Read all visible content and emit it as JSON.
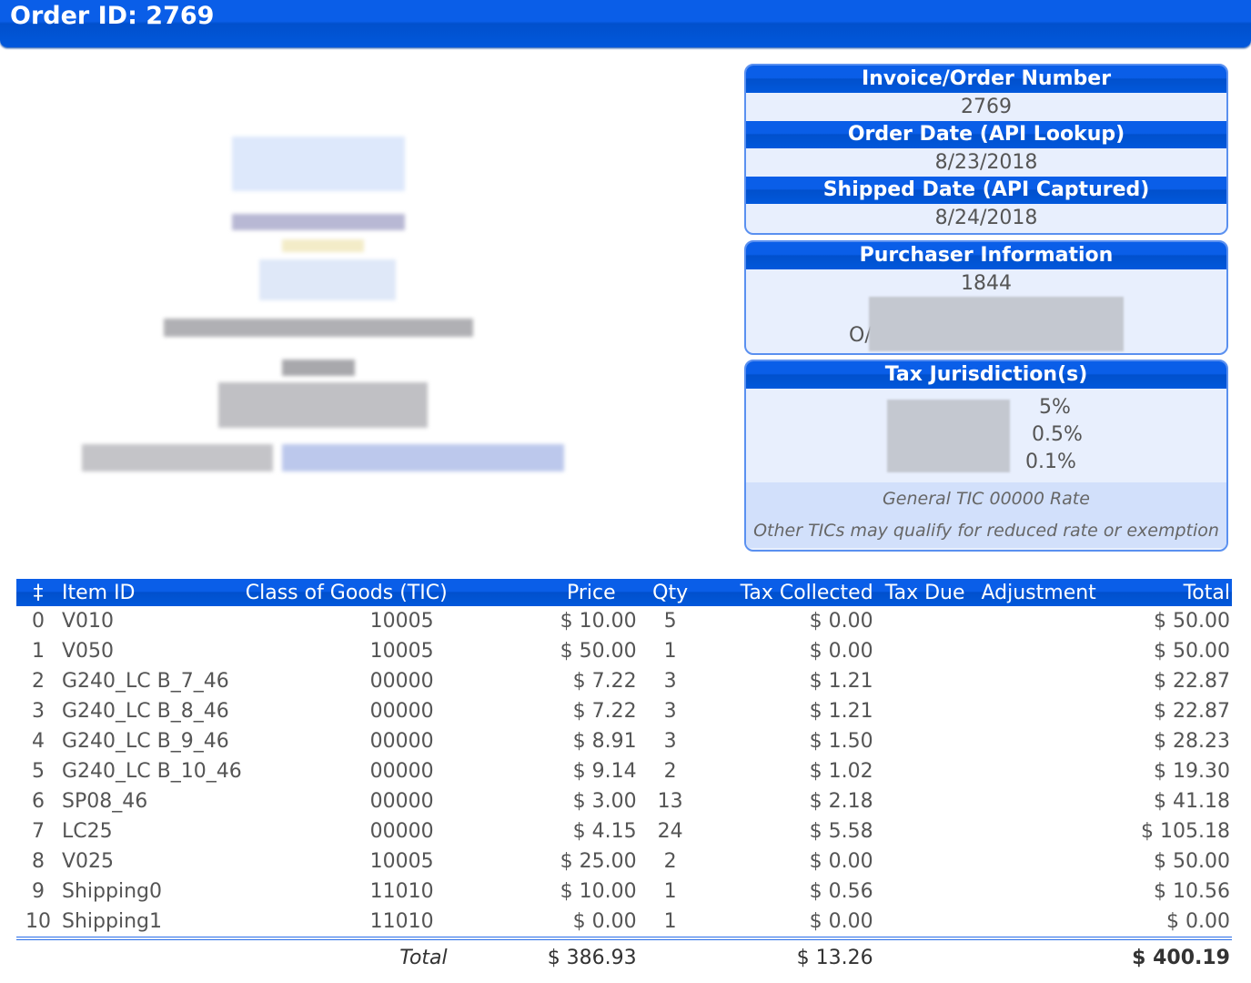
{
  "header": {
    "title": "Order ID: 2769"
  },
  "order_panel": {
    "invoice_label": "Invoice/Order Number",
    "invoice_value": "2769",
    "order_date_label": "Order Date (API Lookup)",
    "order_date_value": "8/23/2018",
    "shipped_date_label": "Shipped Date (API Captured)",
    "shipped_date_value": "8/24/2018"
  },
  "purchaser_panel": {
    "title": "Purchaser Information",
    "id": "1844",
    "address_prefix": "O/"
  },
  "tax_panel": {
    "title": "Tax Jurisdiction(s)",
    "rates": [
      "5%",
      "0.5%",
      "0.1%"
    ],
    "note1": "General TIC 00000 Rate",
    "note2": "Other TICs may qualify for reduced rate or exemption"
  },
  "table": {
    "headers": [
      "‡",
      "Item ID",
      "Class of Goods (TIC)",
      "Price",
      "Qty",
      "Tax Collected",
      "Tax Due",
      "Adjustment",
      "Total"
    ],
    "rows": [
      [
        "0",
        "V010",
        "10005",
        "$ 10.00",
        "5",
        "$ 0.00",
        "",
        "",
        "$ 50.00"
      ],
      [
        "1",
        "V050",
        "10005",
        "$ 50.00",
        "1",
        "$ 0.00",
        "",
        "",
        "$ 50.00"
      ],
      [
        "2",
        "G240_LC B_7_46",
        "00000",
        "$ 7.22",
        "3",
        "$ 1.21",
        "",
        "",
        "$ 22.87"
      ],
      [
        "3",
        "G240_LC B_8_46",
        "00000",
        "$ 7.22",
        "3",
        "$ 1.21",
        "",
        "",
        "$ 22.87"
      ],
      [
        "4",
        "G240_LC B_9_46",
        "00000",
        "$ 8.91",
        "3",
        "$ 1.50",
        "",
        "",
        "$ 28.23"
      ],
      [
        "5",
        "G240_LC B_10_46",
        "00000",
        "$ 9.14",
        "2",
        "$ 1.02",
        "",
        "",
        "$ 19.30"
      ],
      [
        "6",
        "SP08_46",
        "00000",
        "$ 3.00",
        "13",
        "$ 2.18",
        "",
        "",
        "$ 41.18"
      ],
      [
        "7",
        "LC25",
        "00000",
        "$ 4.15",
        "24",
        "$ 5.58",
        "",
        "",
        "$ 105.18"
      ],
      [
        "8",
        "V025",
        "10005",
        "$ 25.00",
        "2",
        "$ 0.00",
        "",
        "",
        "$ 50.00"
      ],
      [
        "9",
        "Shipping0",
        "11010",
        "$ 10.00",
        "1",
        "$ 0.56",
        "",
        "",
        "$ 10.56"
      ],
      [
        "10",
        "Shipping1",
        "11010",
        "$ 0.00",
        "1",
        "$ 0.00",
        "",
        "",
        "$ 0.00"
      ]
    ],
    "total_label": "Total",
    "total_price": "$ 386.93",
    "total_tax": "$ 13.26",
    "total_amount": "$ 400.19"
  }
}
